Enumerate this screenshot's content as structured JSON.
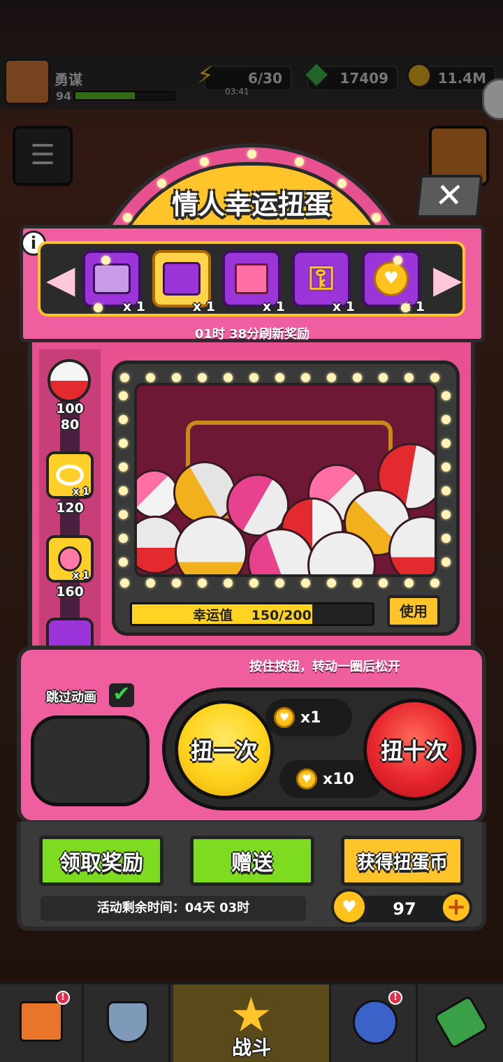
{
  "player": {
    "name": "勇谋",
    "level": "94"
  },
  "resources": {
    "energy": "6/30",
    "energy_timer": "03:41",
    "gems": "17409",
    "gold": "11.4M"
  },
  "event": {
    "title": "情人幸运扭蛋",
    "close_label": "✕",
    "info_label": "i",
    "refresh_text": "01时 38分刷新奖励",
    "rewards": [
      {
        "icon": "purple-chest-icon",
        "count": "x 1"
      },
      {
        "icon": "gold-chest-icon",
        "count": "x 1"
      },
      {
        "icon": "gift-box-icon",
        "count": "x 1"
      },
      {
        "icon": "key-icon",
        "count": "x 1"
      },
      {
        "icon": "heart-coin-icon",
        "count": "x 1"
      }
    ],
    "milestones": [
      {
        "value": "100",
        "icon": "capsule-icon"
      },
      {
        "value": "80",
        "icon": ""
      },
      {
        "value": "120",
        "icon": "ring-icon",
        "count": "x 1"
      },
      {
        "value": "160",
        "icon": "bunny-icon",
        "count": "x 1"
      }
    ],
    "lucky_label": "幸运值",
    "lucky_value": "150/200",
    "lucky_progress": 0.75,
    "use_label": "使用",
    "hint": "按住按钮，转动一圈后松开",
    "skip_label": "跳过动画",
    "skip_checked": true,
    "spin_once_label": "扭一次",
    "spin_once_cost": "x1",
    "spin_ten_label": "扭十次",
    "spin_ten_cost": "x10",
    "claim_label": "领取奖励",
    "gift_label": "赠送",
    "get_coins_label": "获得扭蛋币",
    "time_left": "活动剩余时间：04天 03时",
    "coin_balance": "97",
    "plus_label": "+"
  },
  "nav": {
    "battle_label": "战斗"
  },
  "colors": {
    "pink": "#ef5fa0",
    "yellow": "#ffc42a",
    "green": "#7ddc1f",
    "red": "#e8262e"
  }
}
